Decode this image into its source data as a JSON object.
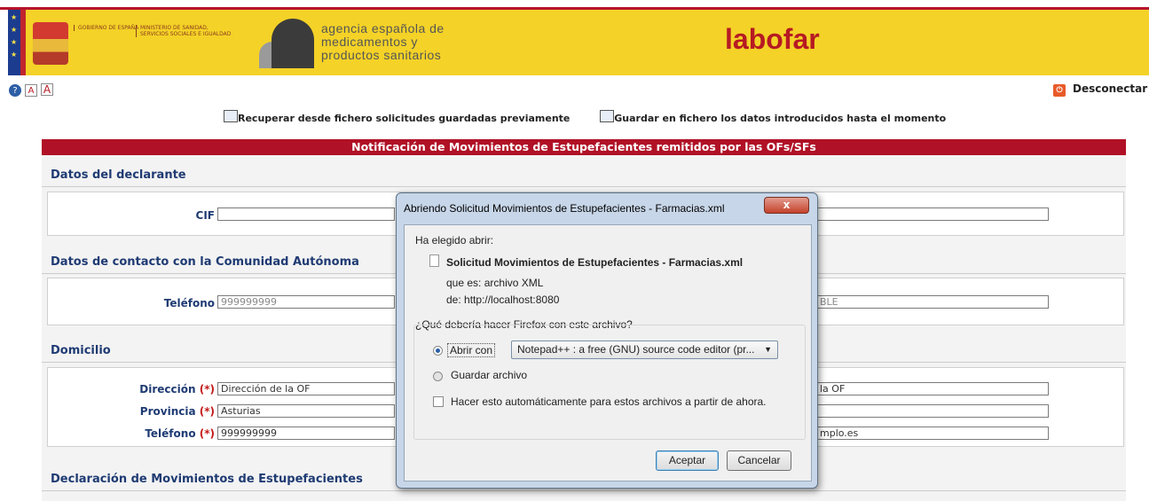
{
  "header": {
    "gobierno": "GOBIERNO DE ESPAÑA",
    "ministerio": "MINISTERIO DE SANIDAD, SERVICIOS SOCIALES E IGUALDAD",
    "aemps_line1": "agencia española de",
    "aemps_line2": "medicamentos y",
    "aemps_line3": "productos sanitarios",
    "labofar": "labofar",
    "logout": "Desconectar"
  },
  "toolbar": {
    "help_icon": "help-icon",
    "font_small": "A",
    "font_large": "A"
  },
  "actions": {
    "recover": "Recuperar desde fichero solicitudes guardadas previamente",
    "save": "Guardar en fichero los datos introducidos hasta el momento"
  },
  "form": {
    "title": "Notificación de Movimientos de Estupefacientes remitidos por las OFs/SFs",
    "sections": {
      "declarante": "Datos del declarante",
      "contacto": "Datos de contacto con la Comunidad Autónoma",
      "domicilio": "Domicilio",
      "declaracion": "Declaración de Movimientos de Estupefacientes"
    },
    "labels": {
      "cif": "CIF",
      "telefono": "Teléfono",
      "direccion": "Dirección",
      "provincia": "Provincia",
      "telefono2": "Teléfono",
      "required": "(*)"
    },
    "values": {
      "cif": "",
      "telefono": "999999999",
      "contacto_right": "BLE",
      "direccion": "Dirección de la OF",
      "direccion_right": "la OF",
      "provincia": "Asturias",
      "telefono2": "999999999",
      "email_right": "mplo.es"
    }
  },
  "dialog": {
    "title": "Abriendo Solicitud Movimientos de Estupefacientes - Farmacias.xml",
    "close": "x",
    "chose": "Ha elegido abrir:",
    "filename": "Solicitud Movimientos de Estupefacientes - Farmacias.xml",
    "type_label": "que es:",
    "type_value": "archivo XML",
    "from_label": "de:",
    "from_value": "http://localhost:8080",
    "question": "¿Qué debería hacer Firefox con este archivo?",
    "open_with": "Abrir con",
    "app": "Notepad++ : a free (GNU) source code editor (pr...",
    "save_file": "Guardar archivo",
    "auto": "Hacer esto automáticamente para estos archivos a partir de ahora.",
    "accept": "Aceptar",
    "cancel": "Cancelar"
  }
}
